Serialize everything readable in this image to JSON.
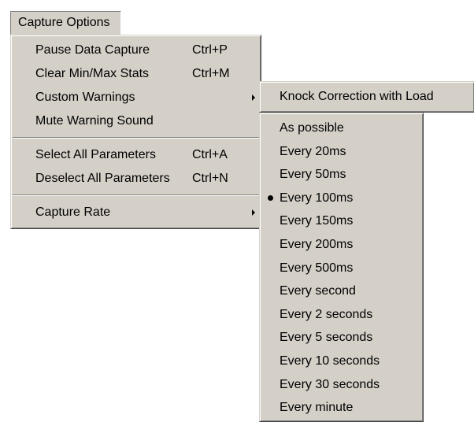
{
  "menubar": {
    "title": "Capture Options"
  },
  "main_menu": {
    "items": [
      {
        "label": "Pause Data Capture",
        "shortcut": "Ctrl+P"
      },
      {
        "label": "Clear Min/Max Stats",
        "shortcut": "Ctrl+M"
      },
      {
        "label": "Custom Warnings",
        "shortcut": "",
        "submenu": true
      },
      {
        "label": "Mute Warning Sound",
        "shortcut": ""
      },
      {
        "label": "Select All Parameters",
        "shortcut": "Ctrl+A"
      },
      {
        "label": "Deselect All Parameters",
        "shortcut": "Ctrl+N"
      },
      {
        "label": "Capture Rate",
        "shortcut": "",
        "submenu": true
      }
    ]
  },
  "warnings_submenu": {
    "items": [
      {
        "label": "Knock Correction with Load"
      }
    ]
  },
  "rate_submenu": {
    "selected_index": 3,
    "items": [
      {
        "label": "As possible"
      },
      {
        "label": "Every 20ms"
      },
      {
        "label": "Every 50ms"
      },
      {
        "label": "Every 100ms"
      },
      {
        "label": "Every 150ms"
      },
      {
        "label": "Every 200ms"
      },
      {
        "label": "Every 500ms"
      },
      {
        "label": "Every second"
      },
      {
        "label": "Every 2 seconds"
      },
      {
        "label": "Every 5 seconds"
      },
      {
        "label": "Every 10 seconds"
      },
      {
        "label": "Every 30 seconds"
      },
      {
        "label": "Every minute"
      }
    ]
  },
  "colors": {
    "menu_face": "#d4d0c8",
    "shadow": "#808080",
    "dark_shadow": "#404040",
    "highlight": "#ffffff"
  }
}
